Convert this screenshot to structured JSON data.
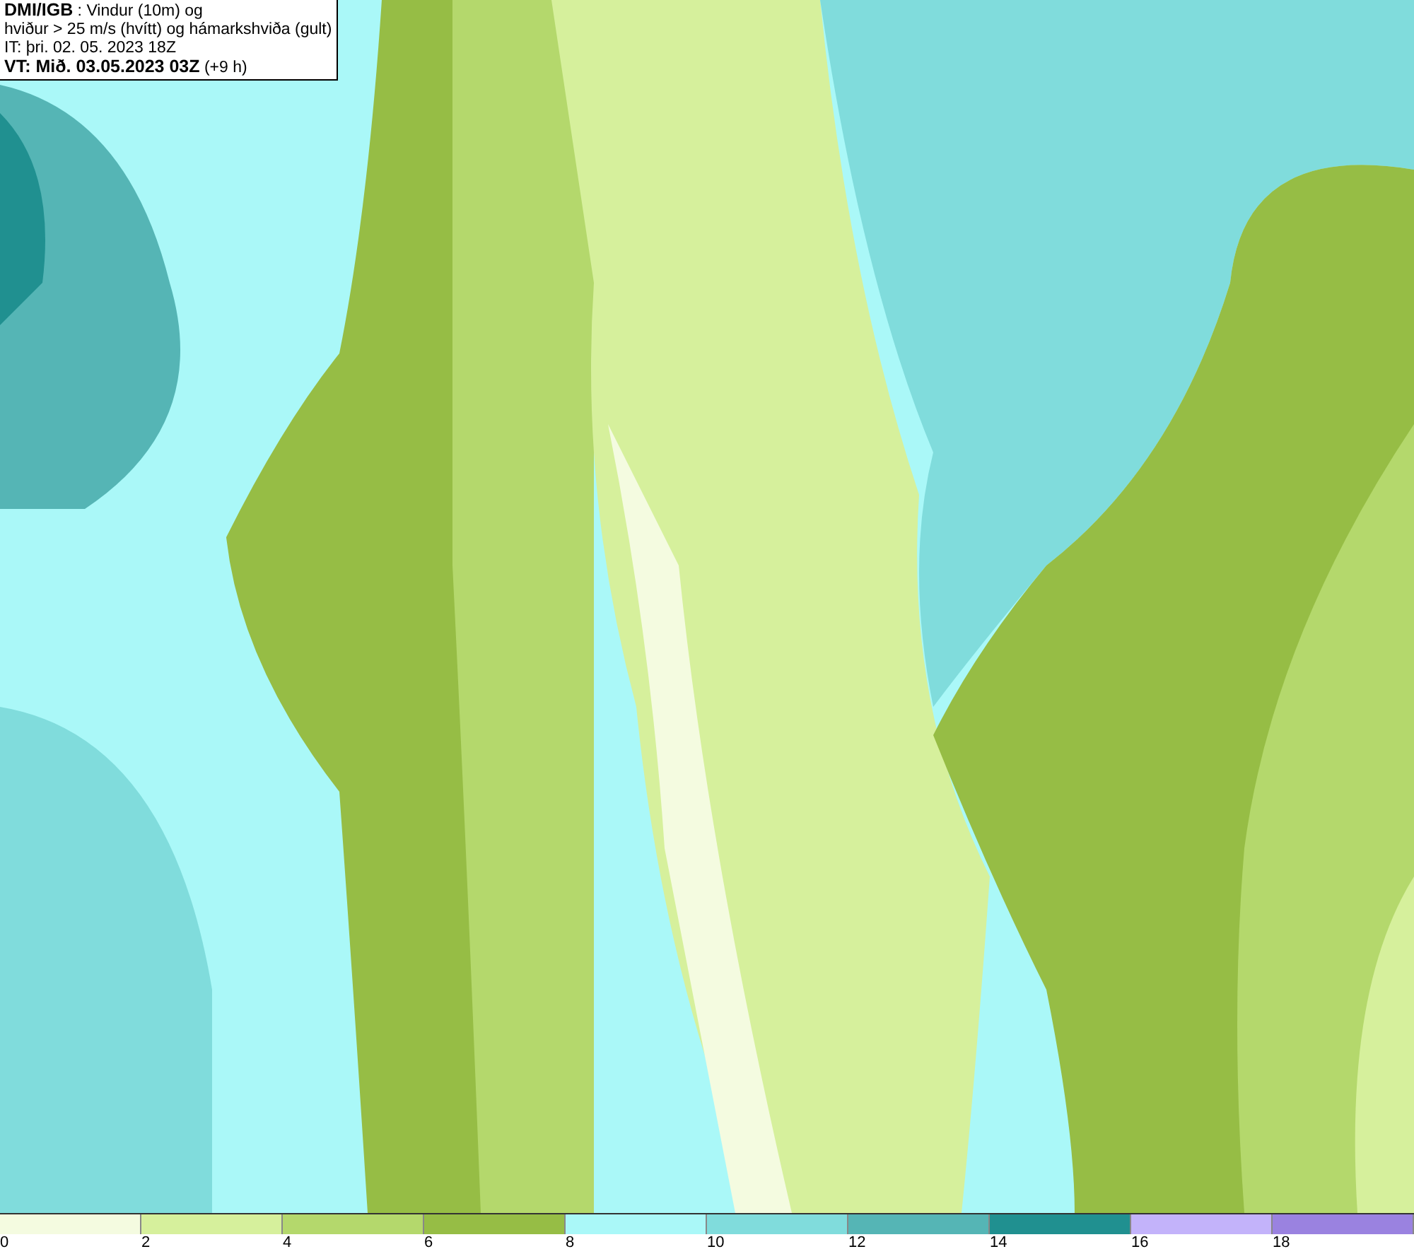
{
  "header": {
    "lines": [
      "**DMI/IGB** : Vindur (10m) og",
      "hviður > 25 m/s (hvítt) og hámarkshviða (gult)",
      "IT: þri. 02. 05. 2023 18Z",
      "**VT: Mið. 03.05.2023 03Z** (+9 h)"
    ]
  },
  "legend": {
    "bins": [
      {
        "label": "0",
        "color": "#f4fbe0"
      },
      {
        "label": "2",
        "color": "#d6f09c"
      },
      {
        "label": "4",
        "color": "#b4d86c"
      },
      {
        "label": "6",
        "color": "#96bd45"
      },
      {
        "label": "8",
        "color": "#aaf8f8"
      },
      {
        "label": "10",
        "color": "#80dcdc"
      },
      {
        "label": "12",
        "color": "#55b5b5"
      },
      {
        "label": "14",
        "color": "#209090"
      },
      {
        "label": "16",
        "color": "#c3b3fa"
      },
      {
        "label": "18",
        "color": "#9a82e0"
      }
    ]
  }
}
